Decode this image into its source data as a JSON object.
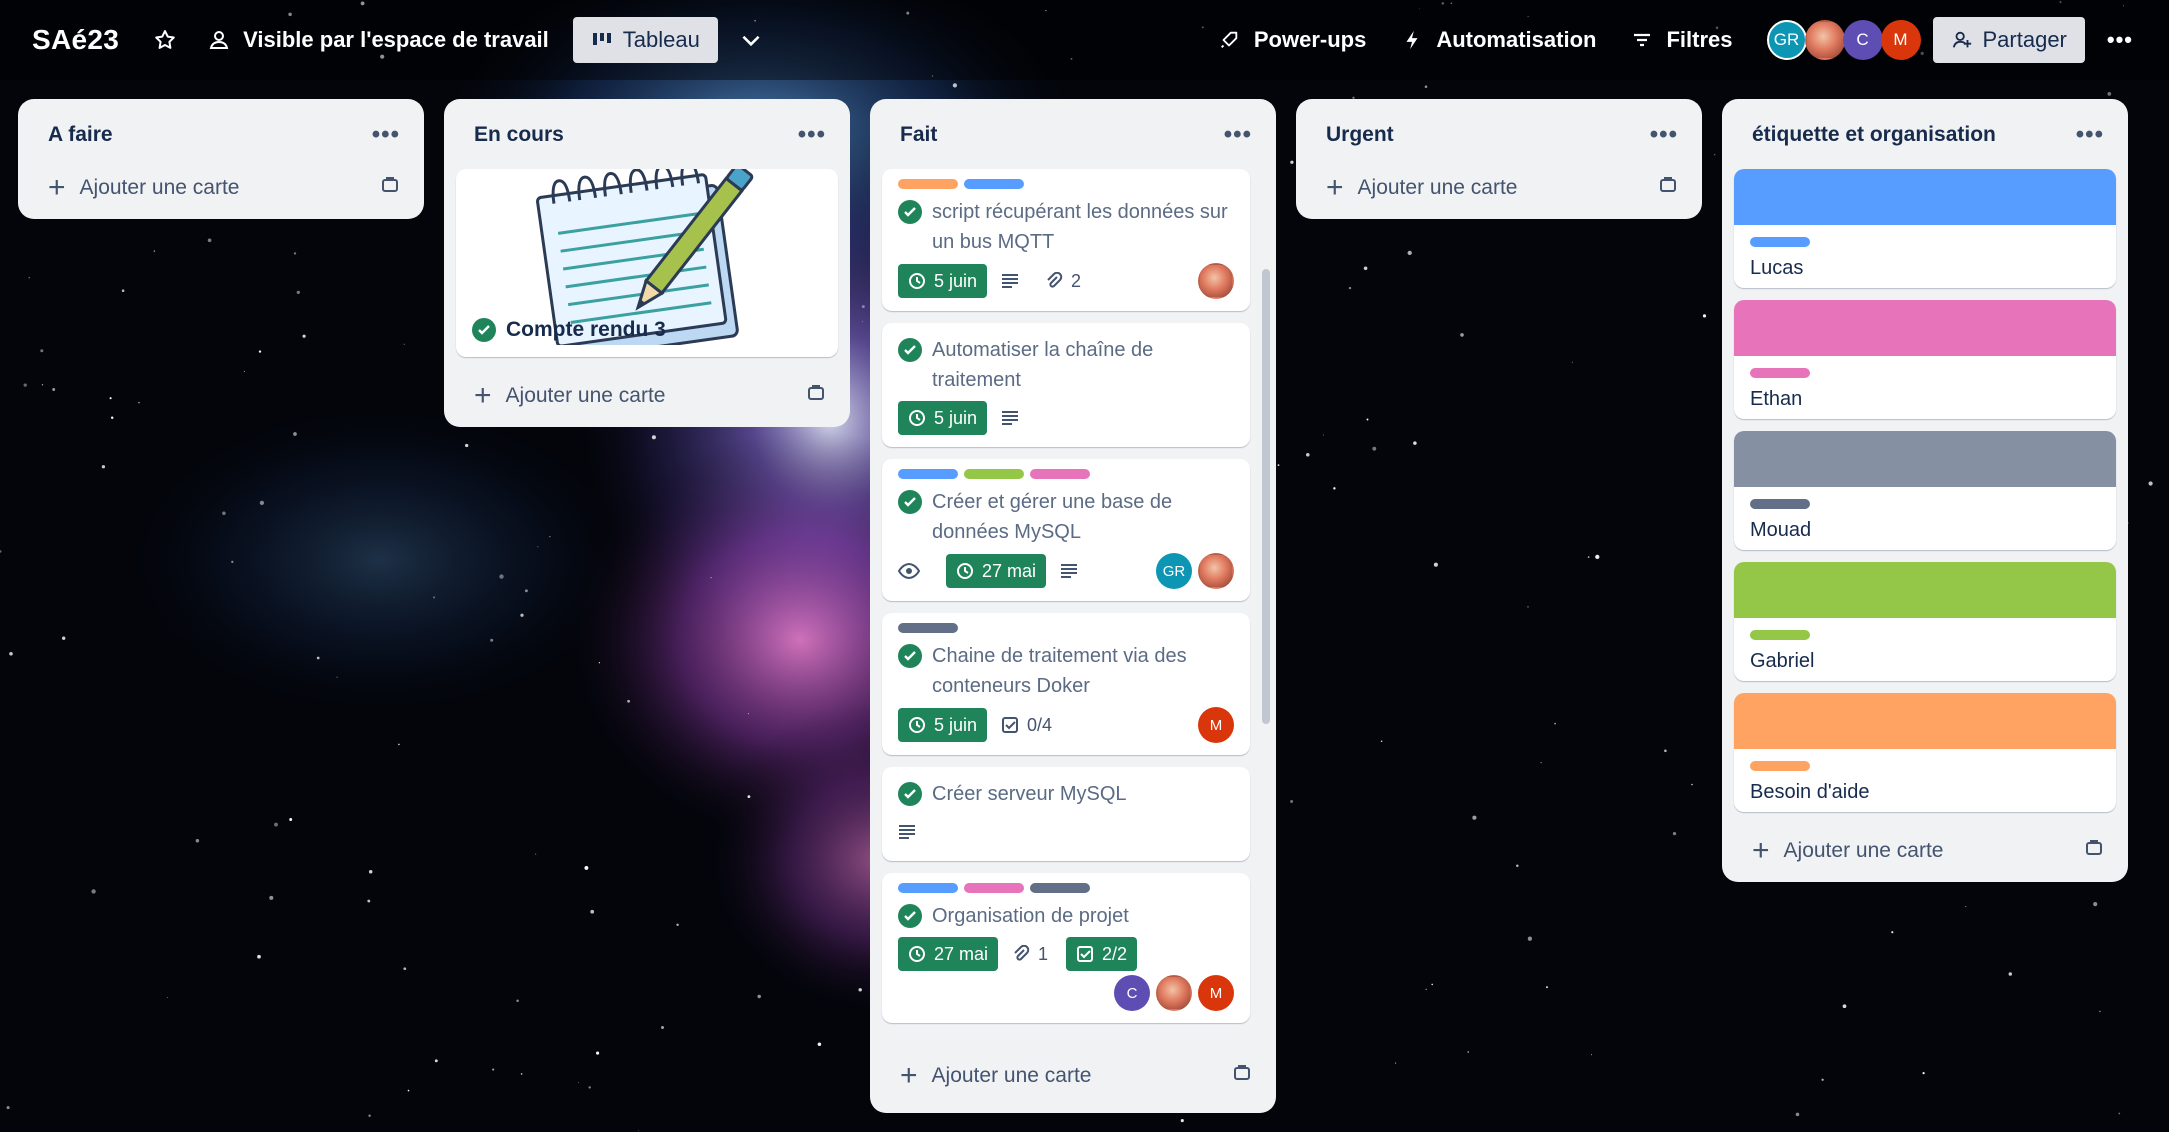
{
  "header": {
    "board_title": "SAé23",
    "visibility": "Visible par l'espace de travail",
    "view": "Tableau",
    "powerups": "Power-ups",
    "automation": "Automatisation",
    "filters": "Filtres",
    "share": "Partager",
    "members": [
      {
        "initials": "GR",
        "color": "#0c96b4"
      },
      {
        "initials": "",
        "color": "#d98b6a",
        "photo": true
      },
      {
        "initials": "C",
        "color": "#5e4db2"
      },
      {
        "initials": "M",
        "color": "#d9360b"
      }
    ]
  },
  "icons": [
    "star-icon",
    "people-icon",
    "board-icon",
    "chevron-down-icon",
    "rocket-icon",
    "bolt-icon",
    "filter-icon",
    "add-person-icon",
    "more-icon",
    "clock-icon",
    "description-icon",
    "attachment-icon",
    "checklist-icon",
    "eye-icon",
    "template-icon",
    "check-circle-icon"
  ],
  "colors": {
    "blue": "#579dff",
    "orange": "#fea362",
    "green": "#94c748",
    "pink": "#e774bb",
    "gray": "#626f86",
    "gray_cover": "#8590a2",
    "done_green": "#1f845a"
  },
  "add_card": "Ajouter une carte",
  "lists": [
    {
      "title": "A faire"
    },
    {
      "title": "En cours",
      "cards": [
        {
          "title": "Compte rendu 3"
        }
      ]
    },
    {
      "title": "Fait",
      "cards": [
        {
          "title": "script récupérant les données sur un bus MQTT",
          "date": "5 juin",
          "attachments": "2"
        },
        {
          "title": "Automatiser la chaîne de traitement",
          "date": "5 juin"
        },
        {
          "title": "Créer et gérer une base de données MySQL",
          "date": "27 mai"
        },
        {
          "title": "Chaine de traitement via des conteneurs Doker",
          "date": "5 juin",
          "checklist": "0/4"
        },
        {
          "title": "Créer serveur MySQL"
        },
        {
          "title": "Organisation de projet",
          "date": "27 mai",
          "attachments": "1",
          "checklist": "2/2"
        }
      ]
    },
    {
      "title": "Urgent"
    },
    {
      "title": "étiquette et organisation",
      "cards": [
        {
          "title": "Lucas",
          "color": "#579dff",
          "cover": "#579dff"
        },
        {
          "title": "Ethan",
          "color": "#e774bb",
          "cover": "#e774bb"
        },
        {
          "title": "Mouad",
          "color": "#626f86",
          "cover": "#8590a2"
        },
        {
          "title": "Gabriel",
          "color": "#94c748",
          "cover": "#94c748"
        },
        {
          "title": "Besoin d'aide",
          "color": "#fea362",
          "cover": "#fea362"
        }
      ]
    }
  ]
}
